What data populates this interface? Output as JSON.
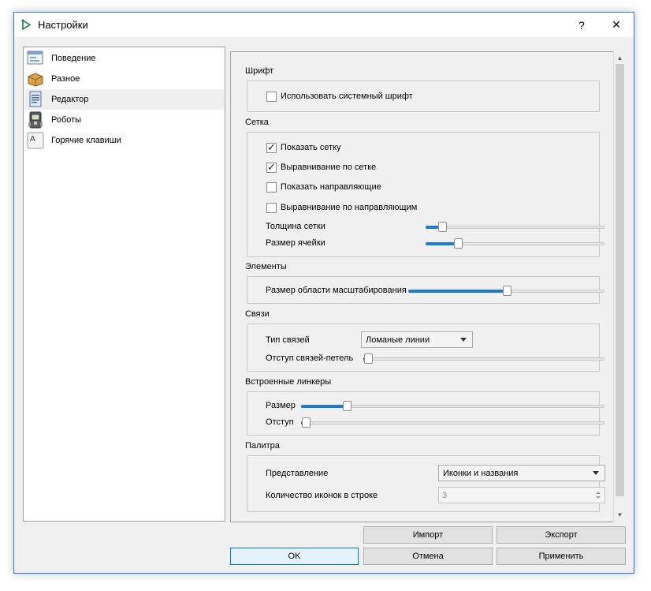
{
  "window": {
    "title": "Настройки",
    "help": "?",
    "close": "✕"
  },
  "nav": {
    "items": [
      {
        "label": "Поведение"
      },
      {
        "label": "Разное"
      },
      {
        "label": "Редактор"
      },
      {
        "label": "Роботы"
      },
      {
        "label": "Горячие клавиши"
      }
    ],
    "selected": "Редактор"
  },
  "font": {
    "title": "Шрифт",
    "use_system": "Использовать системный шрифт",
    "use_system_checked": false
  },
  "grid": {
    "title": "Сетка",
    "show_grid": "Показать сетку",
    "show_grid_checked": true,
    "snap_grid": "Выравнивание по сетке",
    "snap_grid_checked": true,
    "show_guides": "Показать направляющие",
    "show_guides_checked": false,
    "snap_guides": "Выравнивание по направляющим",
    "snap_guides_checked": false,
    "thickness_label": "Толщина сетки",
    "thickness_value": 0.07,
    "cell_label": "Размер ячейки",
    "cell_value": 0.16
  },
  "elements": {
    "title": "Элементы",
    "zoom_label": "Размер области масштабирования",
    "zoom_value": 0.5
  },
  "links": {
    "title": "Связи",
    "type_label": "Тип связей",
    "type_value": "Ломаные линии",
    "loop_label": "Отступ связей-петель",
    "loop_value": 0.0
  },
  "linkers": {
    "title": "Встроенные линкеры",
    "size_label": "Размер",
    "size_value": 0.14,
    "indent_label": "Отступ",
    "indent_value": 0.0
  },
  "palette": {
    "title": "Палитра",
    "view_label": "Представление",
    "view_value": "Иконки и названия",
    "count_label": "Количество иконок в строке",
    "count_value": "3"
  },
  "buttons": {
    "import": "Импорт",
    "export": "Экспорт",
    "ok": "OK",
    "cancel": "Отмена",
    "apply": "Применить"
  }
}
